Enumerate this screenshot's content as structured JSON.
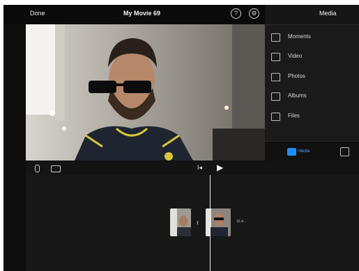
{
  "topbar": {
    "done_label": "Done",
    "title": "My Movie 69",
    "help_icon": "?",
    "settings_icon": "⚙"
  },
  "media": {
    "title": "Media",
    "items": [
      {
        "label": "Moments",
        "icon": "moments-icon"
      },
      {
        "label": "Video",
        "icon": "video-icon"
      },
      {
        "label": "Photos",
        "icon": "photos-icon"
      },
      {
        "label": "Albums",
        "icon": "albums-icon"
      },
      {
        "label": "Files",
        "icon": "files-icon"
      }
    ],
    "footer_tab_label": "Media",
    "accent": "#1e8ef5"
  },
  "timeline": {
    "skip_icon": "I◂",
    "play_icon": "▶",
    "clip_label": "16.4..."
  }
}
